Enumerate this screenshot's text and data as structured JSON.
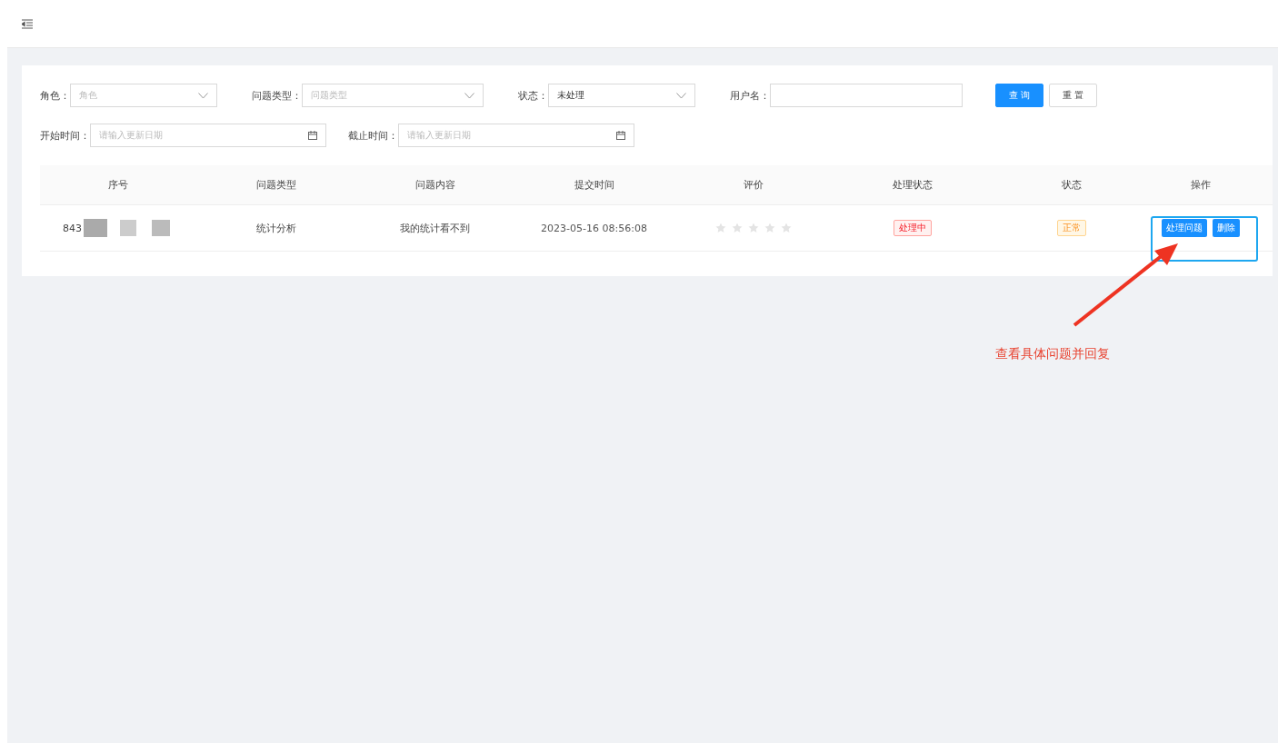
{
  "filters": [
    {
      "label": "角色：",
      "kind": "select",
      "placeholder": "角色"
    },
    {
      "label": "问题类型：",
      "kind": "select",
      "placeholder": "问题类型"
    },
    {
      "label": "状态：",
      "kind": "select",
      "value": "未处理"
    },
    {
      "label": "用户名：",
      "kind": "input"
    }
  ],
  "buttons": [
    {
      "label": "查 询",
      "kind": "primary"
    },
    {
      "label": "重 置",
      "kind": "default"
    }
  ],
  "dates": [
    {
      "label": "开始时间：",
      "placeholder": "请输入更新日期"
    },
    {
      "label": "截止时间：",
      "placeholder": "请输入更新日期"
    }
  ],
  "table": {
    "columns": [
      "序号",
      "问题类型",
      "问题内容",
      "提交时间",
      "评价",
      "处理状态",
      "状态",
      "操作"
    ],
    "rows": [
      {
        "id": "843",
        "type": "统计分析",
        "content": "我的统计看不到",
        "time": "2023-05-16 08:56:08",
        "stars": 0,
        "process_status": "处理中",
        "status": "正常",
        "actions": [
          "处理问题",
          "删除"
        ]
      }
    ]
  },
  "annotation": {
    "text": "查看具体问题并回复"
  }
}
